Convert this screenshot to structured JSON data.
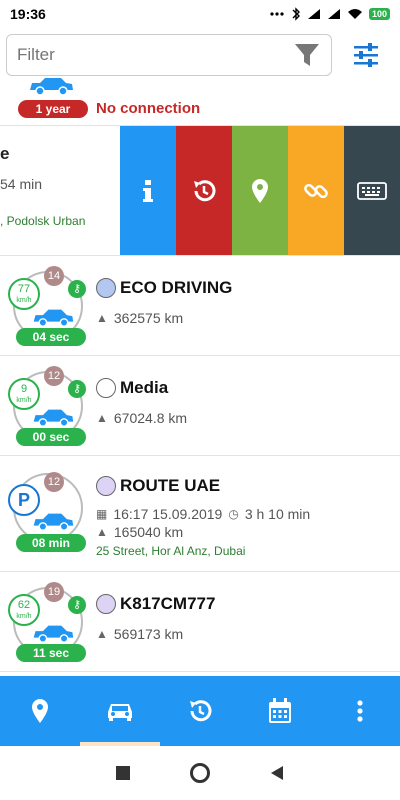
{
  "status_bar": {
    "time": "19:36",
    "battery": "100"
  },
  "filter": {
    "placeholder": "Filter"
  },
  "top_partial_row": {
    "badge": "1 year",
    "status": "No connection"
  },
  "swipe_row": {
    "name_fragment": "e",
    "duration_fragment": "54 min",
    "address_fragment": ", Podolsk Urban"
  },
  "vehicles": [
    {
      "name": "ECO DRIVING",
      "speed": "77",
      "unit": "km/h",
      "sat_count": "14",
      "time_badge": "04 sec",
      "mileage": "362575 km",
      "dot_color": "#b3c7f0"
    },
    {
      "name": "Media",
      "speed": "9",
      "unit": "km/h",
      "sat_count": "12",
      "time_badge": "00 sec",
      "mileage": "67024.8 km",
      "dot_color": "#ffffff"
    },
    {
      "name": "ROUTE UAE",
      "parking": "P",
      "sat_count": "12",
      "time_badge": "08 min",
      "date": "16:17 15.09.2019",
      "duration": "3 h 10 min",
      "mileage": "165040 km",
      "address": "25 Street, Hor Al Anz, Dubai",
      "dot_color": "#dcd3f5"
    },
    {
      "name": "K817CM777",
      "speed": "62",
      "unit": "km/h",
      "sat_count": "19",
      "time_badge": "11 sec",
      "mileage": "569173 km",
      "dot_color": "#dcd3f5"
    }
  ],
  "colors": {
    "primary": "#2196f3",
    "no_connection": "#c62828",
    "green": "#2bb24c",
    "swipe_info": "#2196f3",
    "swipe_history": "#c62828",
    "swipe_location": "#7cb342",
    "swipe_link": "#f9a825",
    "swipe_command": "#37474f"
  },
  "icons": {
    "filter": "funnel-icon",
    "settings": "sliders-icon",
    "nav": [
      "location-pin-icon",
      "car-icon",
      "history-icon",
      "calendar-icon",
      "more-vertical-icon"
    ]
  }
}
